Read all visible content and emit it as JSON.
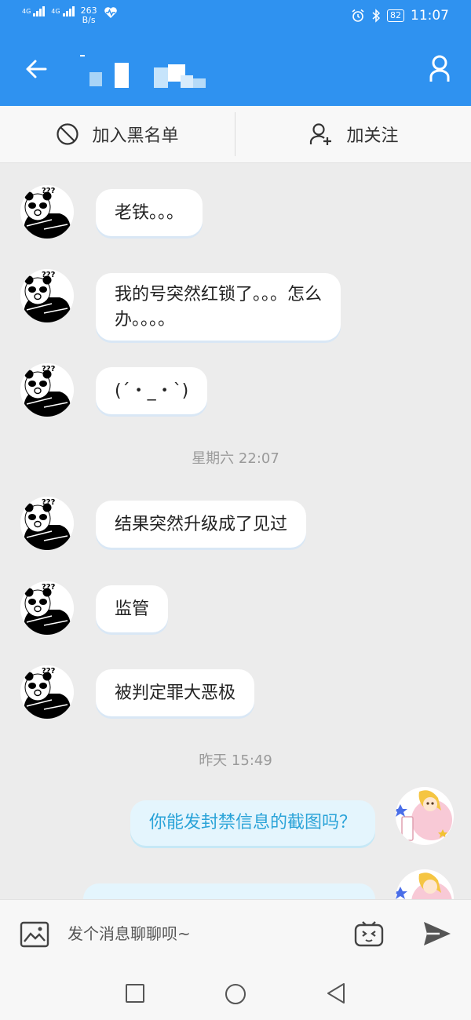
{
  "status_bar": {
    "signal1": "4G",
    "signal2": "4G",
    "speed_value": "263",
    "speed_unit": "B/s",
    "battery": "82",
    "time": "11:07"
  },
  "app_bar": {
    "back_icon": "back-arrow-icon",
    "profile_icon": "person-icon"
  },
  "actions": {
    "block_label": "加入黑名单",
    "follow_label": "加关注"
  },
  "messages": [
    {
      "text": "老铁。。。"
    },
    {
      "text": "我的号突然红锁了。。。怎么"
    },
    {
      "text": "办。。。。"
    },
    {
      "text": "(´・_・`)"
    },
    {
      "text": "结果突然升级成了见过"
    },
    {
      "text": "监管"
    },
    {
      "text": "被判定罪大恶极"
    }
  ],
  "timestamps": {
    "t1": "星期六 22:07",
    "t2": "昨天 15:49"
  },
  "outgoing": [
    {
      "text": "你能发封禁信息的截图吗？"
    }
  ],
  "input": {
    "placeholder": "发个消息聊聊呗~"
  },
  "colors": {
    "accent": "#2f92f0",
    "outgoing_text": "#2aa3d8",
    "outgoing_bubble": "#e4f5fd"
  }
}
